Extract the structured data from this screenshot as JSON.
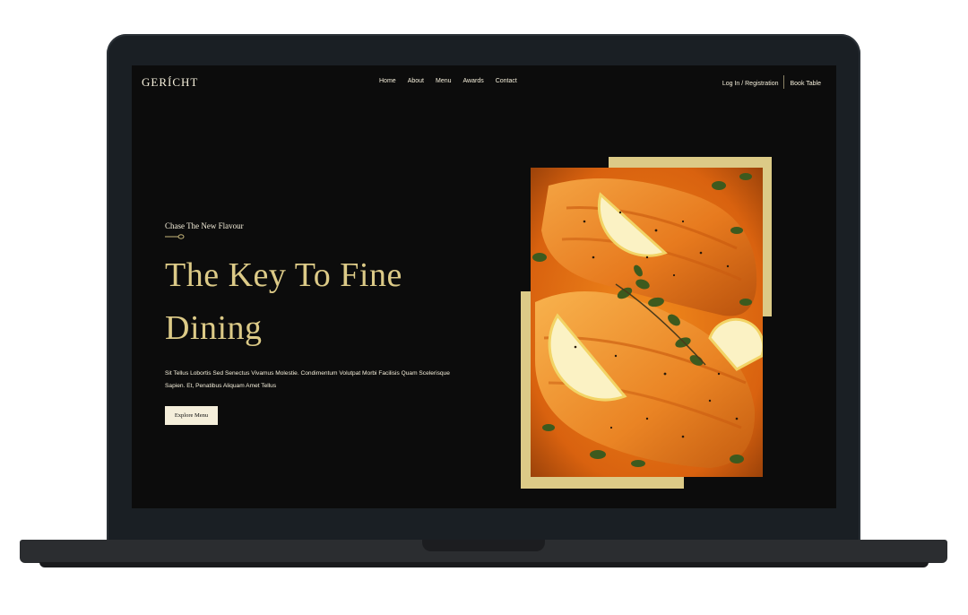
{
  "site": {
    "logo": "GERÍCHT",
    "nav_links": [
      "Home",
      "About",
      "Menu",
      "Awards",
      "Contact"
    ],
    "login_label": "Log In / Registration",
    "book_label": "Book Table"
  },
  "hero": {
    "subtitle": "Chase The New Flavour",
    "title": "The Key To Fine Dining",
    "description": "Sit Tellus Lobortis Sed Senectus Vivamus Molestie. Condimentum Volutpat Morbi Facilisis Quam Scelerisque Sapien. Et, Penatibus Aliquam Amet Tellus",
    "button_label": "Explore Menu"
  },
  "colors": {
    "background": "#0c0c0c",
    "accent_gold": "#dcca87",
    "text_cream": "#f5efdb",
    "laptop_bezel": "#1a1f24",
    "laptop_base": "#2b2d30"
  },
  "icons": {
    "spoon": "spoon-icon"
  }
}
